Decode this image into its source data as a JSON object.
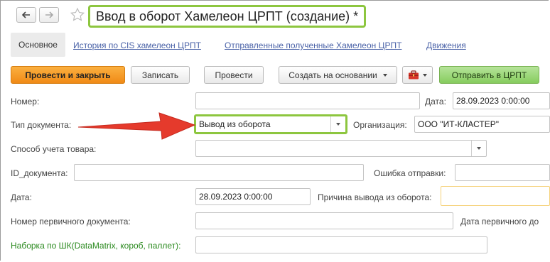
{
  "window": {
    "title": "Ввод в оборот Хамелеон ЦРПТ (создание) *"
  },
  "tabs": {
    "main": "Основное",
    "links": [
      "История по CIS хамелеон ЦРПТ",
      "Отправленные полученные Хамелеон ЦРПТ",
      "Движения"
    ]
  },
  "toolbar": {
    "post_close": "Провести и закрыть",
    "save": "Записать",
    "post": "Провести",
    "create_based": "Создать на основании",
    "send": "Отправить в ЦРПТ"
  },
  "form": {
    "number_label": "Номер:",
    "number_value": "",
    "date_label": "Дата:",
    "date_value": "28.09.2023  0:00:00",
    "doctype_label": "Тип документа:",
    "doctype_value": "Вывод из оборота",
    "org_label": "Организация:",
    "org_value": "ООО \"ИТ-КЛАСТЕР\"",
    "accounting_label": "Способ учета товара:",
    "accounting_value": "",
    "docid_label": "ID_документа:",
    "docid_value": "",
    "senderr_label": "Ошибка отправки:",
    "senderr_value": "",
    "date2_label": "Дата:",
    "date2_value": "28.09.2023  0:00:00",
    "reason_label": "Причина вывода из оборота:",
    "reason_value": "",
    "primary_num_label": "Номер первичного документа:",
    "primary_num_value": "",
    "primary_date_label": "Дата первичного до",
    "barcode_label": "Наборка по ШК(DataMatrix, короб, паллет):",
    "barcode_value": ""
  },
  "colors": {
    "highlight": "#8dc63f",
    "arrow": "#e53a2c",
    "primary_button": "#f08a16",
    "send_button": "#86cc5e",
    "link": "#4b63a8"
  }
}
